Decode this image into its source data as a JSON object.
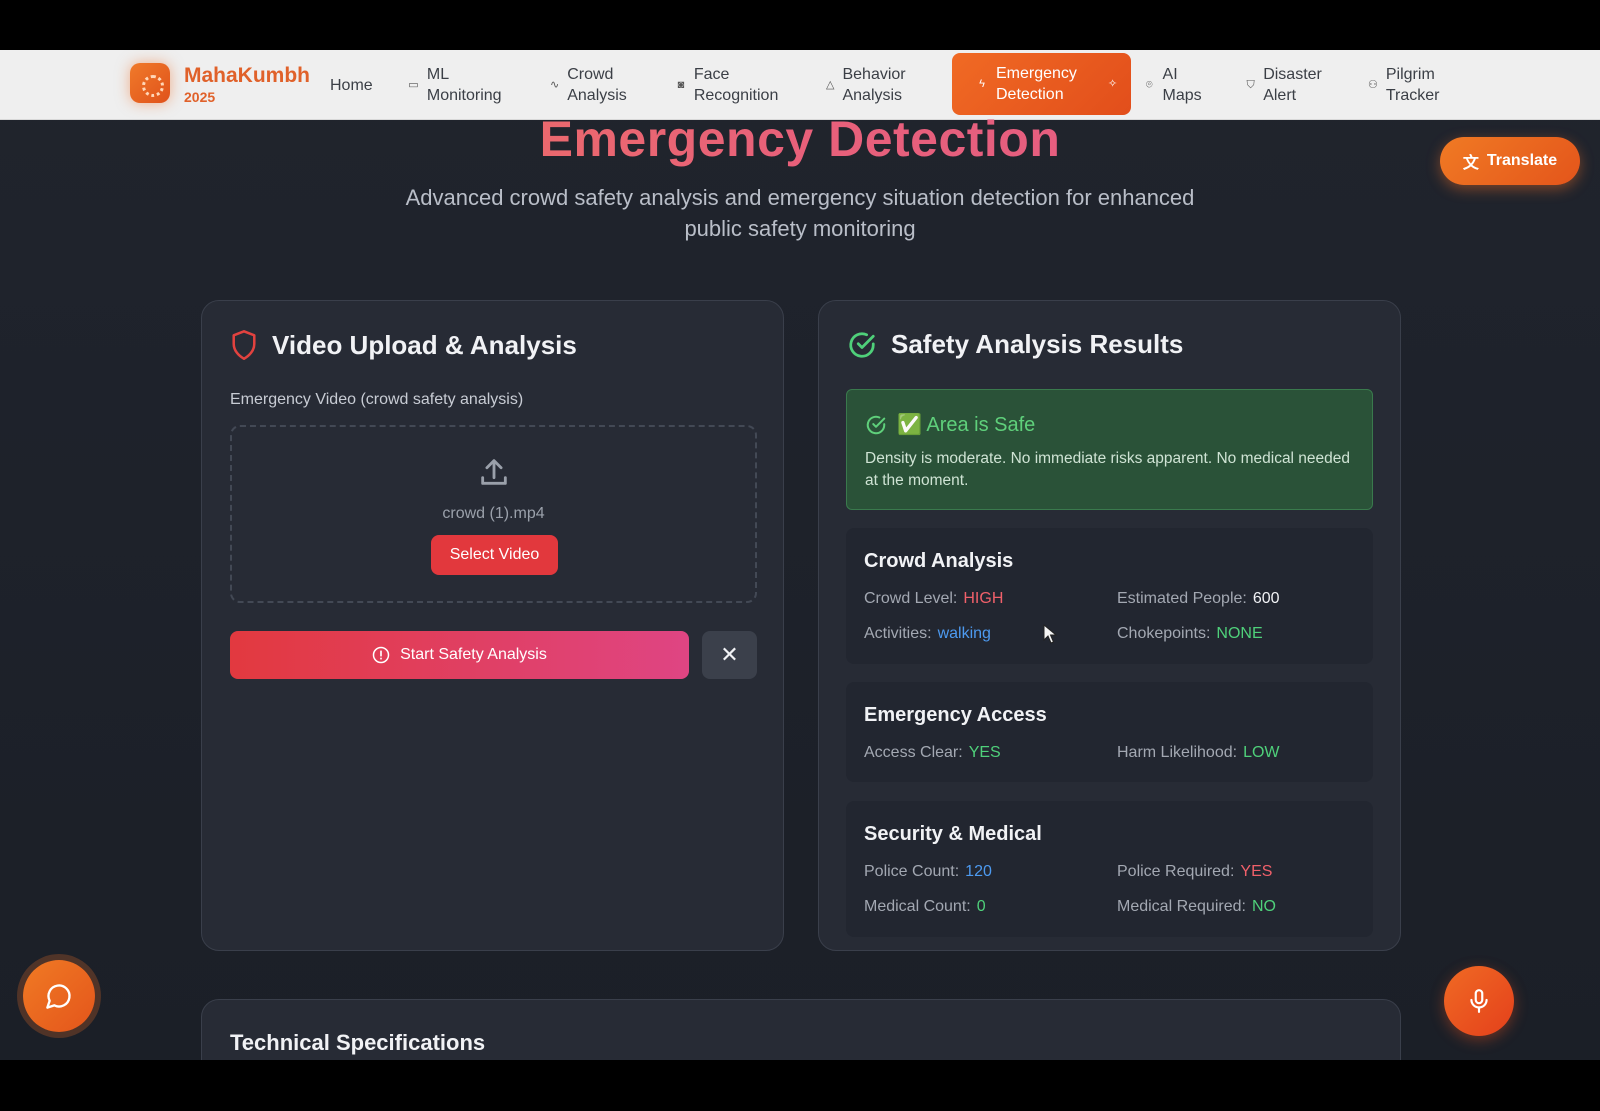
{
  "brand": {
    "name": "MahaKumbh",
    "year": "2025"
  },
  "nav": {
    "items": [
      {
        "label": "Home",
        "icon": ""
      },
      {
        "label": "ML Monitoring",
        "icon": "monitor-icon"
      },
      {
        "label": "Crowd Analysis",
        "icon": "activity-icon"
      },
      {
        "label": "Face Recognition",
        "icon": "camera-icon"
      },
      {
        "label": "Behavior Analysis",
        "icon": "warning-icon"
      },
      {
        "label": "Emergency Detection",
        "icon": "zap-icon",
        "active": true
      },
      {
        "label": "AI Maps",
        "icon": "map-pin-icon"
      },
      {
        "label": "Disaster Alert",
        "icon": "shield-icon"
      },
      {
        "label": "Pilgrim Tracker",
        "icon": "users-icon"
      }
    ]
  },
  "hero": {
    "title": "Emergency Detection",
    "subtitle": "Advanced crowd safety analysis and emergency situation detection for enhanced public safety monitoring"
  },
  "translate": {
    "label": "Translate"
  },
  "upload": {
    "title": "Video Upload & Analysis",
    "field_label": "Emergency Video (crowd safety analysis)",
    "file_name": "crowd (1).mp4",
    "select_label": "Select Video",
    "start_label": "Start Safety Analysis",
    "clear_label": "✕"
  },
  "results": {
    "title": "Safety Analysis Results",
    "status_title": "✅ Area is Safe",
    "status_text": "Density is moderate. No immediate risks apparent. No medical needed at the moment.",
    "crowd": {
      "title": "Crowd Analysis",
      "crowd_level_label": "Crowd Level:",
      "crowd_level": "HIGH",
      "people_label": "Estimated People:",
      "people": "600",
      "activities_label": "Activities:",
      "activities": "walking",
      "chokepoints_label": "Chokepoints:",
      "chokepoints": "NONE"
    },
    "access": {
      "title": "Emergency Access",
      "access_label": "Access Clear:",
      "access": "YES",
      "harm_label": "Harm Likelihood:",
      "harm": "LOW"
    },
    "security": {
      "title": "Security & Medical",
      "police_count_label": "Police Count:",
      "police_count": "120",
      "police_req_label": "Police Required:",
      "police_req": "YES",
      "medical_count_label": "Medical Count:",
      "medical_count": "0",
      "medical_req_label": "Medical Required:",
      "medical_req": "NO"
    }
  },
  "tech": {
    "title": "Technical Specifications"
  },
  "colors": {
    "accent": "#e8561f",
    "safe": "#4fd07a",
    "danger": "#f0606a",
    "info": "#4d9af0"
  }
}
